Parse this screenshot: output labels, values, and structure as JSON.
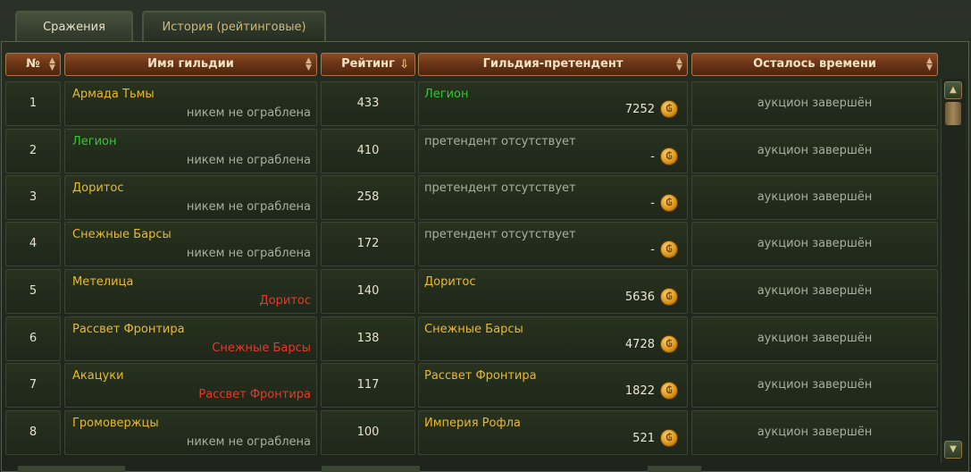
{
  "tabs": [
    {
      "label": "Сражения"
    },
    {
      "label": "История (рейтинговые)"
    }
  ],
  "columns": {
    "num": "№",
    "guild": "Имя гильдии",
    "rating": "Рейтинг",
    "challenger": "Гильдия-претендент",
    "time_left": "Осталось времени"
  },
  "colors": {
    "guild_gold": "#e8b931",
    "guild_green": "#39c43a",
    "robbed_red": "#e23b2c",
    "muted": "#aab09f",
    "header_brown": "#6c3617"
  },
  "rows": [
    {
      "num": "1",
      "guild": "Армада Тьмы",
      "robbed_by": "никем не ограблена",
      "rating": "433",
      "challenger": "Легион",
      "bid": "7252",
      "time": "аукцион завершён"
    },
    {
      "num": "2",
      "guild": "Легион",
      "robbed_by": "никем не ограблена",
      "rating": "410",
      "challenger": "претендент отсутствует",
      "bid": "-",
      "time": "аукцион завершён"
    },
    {
      "num": "3",
      "guild": "Доритос",
      "robbed_by": "никем не ограблена",
      "rating": "258",
      "challenger": "претендент отсутствует",
      "bid": "-",
      "time": "аукцион завершён"
    },
    {
      "num": "4",
      "guild": "Снежные Барсы",
      "robbed_by": "никем не ограблена",
      "rating": "172",
      "challenger": "претендент отсутствует",
      "bid": "-",
      "time": "аукцион завершён"
    },
    {
      "num": "5",
      "guild": "Метелица",
      "robbed_by": "Доритос",
      "rating": "140",
      "challenger": "Доритос",
      "bid": "5636",
      "time": "аукцион завершён"
    },
    {
      "num": "6",
      "guild": "Рассвет Фронтира",
      "robbed_by": "Снежные Барсы",
      "rating": "138",
      "challenger": "Снежные Барсы",
      "bid": "4728",
      "time": "аукцион завершён"
    },
    {
      "num": "7",
      "guild": "Акацуки",
      "robbed_by": "Рассвет Фронтира",
      "rating": "117",
      "challenger": "Рассвет Фронтира",
      "bid": "1822",
      "time": "аукцион завершён"
    },
    {
      "num": "8",
      "guild": "Громовержцы",
      "robbed_by": "никем не ограблена",
      "rating": "100",
      "challenger": "Империя Рофла",
      "bid": "521",
      "time": "аукцион завершён"
    }
  ],
  "icons": {
    "coin": "gold-coin-icon",
    "sort": "sort-arrows-icon",
    "sort_active": "sort-down-arrow-icon"
  }
}
